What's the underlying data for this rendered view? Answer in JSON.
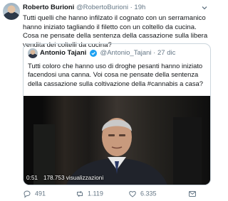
{
  "tweet": {
    "author_name": "Roberto Burioni",
    "author_handle": "@RobertoBurioni",
    "time": "19h",
    "text": "Tutti quelli che hanno infilzato il cognato con un serramanico hanno iniziato tagliando il filetto con un coltello da cucina. Cosa ne pensate della sentenza della cassazione sulla libera vendita dei coltelli da cucina?"
  },
  "quoted": {
    "author_name": "Antonio Tajani",
    "author_handle": "@Antonio_Tajani",
    "time": "27 dic",
    "text": "Tutti coloro che hanno uso di droghe pesanti hanno iniziato facendosi una canna. Voi cosa ne pensate della sentenza della cassazione sulla coltivazione della #cannabis a casa?",
    "video": {
      "duration": "0:51",
      "views": "178.753 visualizzazioni"
    }
  },
  "actions": {
    "replies": "491",
    "retweets": "1.119",
    "likes": "6.335"
  },
  "colors": {
    "link": "#1da1f2",
    "muted": "#657786",
    "border": "#ccd6dd"
  },
  "icons": [
    "chevron-down-icon",
    "verified-icon",
    "reply-icon",
    "retweet-icon",
    "like-icon",
    "direct-message-icon"
  ]
}
